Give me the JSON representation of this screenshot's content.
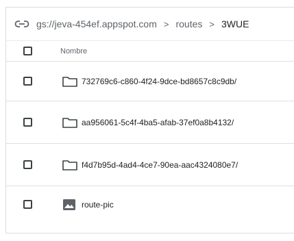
{
  "breadcrumb": {
    "link_icon": "link-icon",
    "items": [
      {
        "label": "gs://jeva-454ef.appspot.com"
      },
      {
        "label": "routes"
      },
      {
        "label": "3WUE"
      }
    ],
    "separator": ">"
  },
  "table": {
    "header": {
      "name_label": "Nombre"
    },
    "rows": [
      {
        "name": "732769c6-c860-4f24-9dce-bd8657c8c9db/",
        "icon": "folder-icon"
      },
      {
        "name": "aa956061-5c4f-4ba5-afab-37ef0a8b4132/",
        "icon": "folder-icon"
      },
      {
        "name": "f4d7b95d-4ad4-4ce7-90ea-aac4324080e7/",
        "icon": "folder-icon"
      },
      {
        "name": "route-pic",
        "icon": "image-icon"
      }
    ]
  },
  "colors": {
    "text": "#3c4043",
    "muted": "#5f6368",
    "divider": "#e0e0e0"
  }
}
